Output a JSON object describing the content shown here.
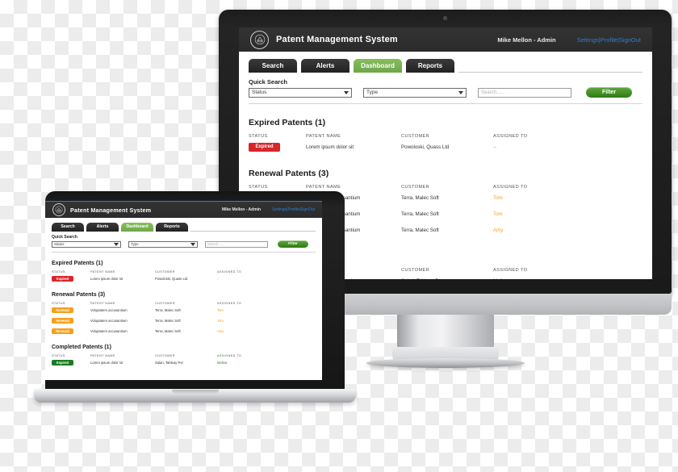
{
  "app": {
    "title": "Patent Management System",
    "logo_icon": "patent-crest-icon",
    "user": {
      "name": "Mike Mellon - Admin",
      "links": "Settings|Profile|SignOut"
    },
    "tabs": [
      {
        "label": "Search",
        "active": false
      },
      {
        "label": "Alerts",
        "active": false
      },
      {
        "label": "Dashboard",
        "active": true
      },
      {
        "label": "Reports",
        "active": false
      }
    ],
    "quick_search": {
      "label": "Quick Search",
      "status_select": "Status",
      "type_select": "Type",
      "search_placeholder": "Search......",
      "search_value": "",
      "filter_button": "Filter",
      "dropdown_icon": "chevron-down-icon"
    },
    "columns": [
      "STATUS",
      "PATENT NAME",
      "CUSTOMER",
      "ASSIGNED TO"
    ],
    "sections": [
      {
        "title": "Expired Patents (1)",
        "rows": [
          {
            "status": "Expired",
            "status_kind": "expired",
            "name": "Lorem ipsum dolor sit",
            "customer": "Powoloski, Quass Ltd",
            "assigned": "--",
            "assigned_kind": "dash"
          }
        ]
      },
      {
        "title": "Renewal Patents (3)",
        "rows": [
          {
            "status": "Renewal",
            "status_kind": "renewal",
            "name": "Voluptatem accusantium",
            "customer": "Terra, Malec  Soft",
            "assigned": "Tom",
            "assigned_kind": "orange"
          },
          {
            "status": "Renewal",
            "status_kind": "renewal",
            "name": "Voluptatem accusantium",
            "customer": "Terra, Malec  Soft",
            "assigned": "Tom",
            "assigned_kind": "orange"
          },
          {
            "status": "Renewal",
            "status_kind": "renewal",
            "name": "Voluptatem accusantium",
            "customer": "Terra, Malec  Soft",
            "assigned": "Amy",
            "assigned_kind": "orange"
          }
        ]
      },
      {
        "title": "Completed Patents (1)",
        "rows": [
          {
            "status": "Expired",
            "status_kind": "completed",
            "name": "Lorem ipsum dolor sit",
            "customer": "Salari, Tableay Pvt",
            "assigned": "Melina",
            "assigned_kind": "green"
          }
        ]
      }
    ]
  },
  "colors": {
    "accent_green": "#77b14f",
    "filter_green": "#2f7a14",
    "expired_red": "#d8252a",
    "renewal_orange": "#f5a01c",
    "completed_green": "#1b7a22",
    "link_blue": "#2f7fd1",
    "header_dark": "#2b2b2b"
  }
}
